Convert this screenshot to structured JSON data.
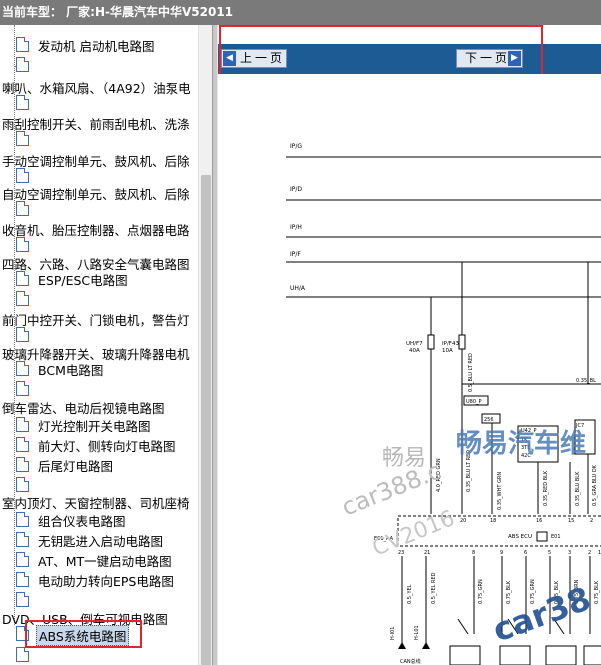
{
  "titlebar": {
    "text": "当前车型：  厂家:H-华晨汽车中华V52011"
  },
  "sidebar": {
    "items": [
      {
        "label": "发动机  启动机电路图"
      },
      {
        "label": "喇叭、水箱风扇、（4A92）油泵电"
      },
      {
        "label": "雨刮控制开关、前雨刮电机、洗涤"
      },
      {
        "label": "手动空调控制单元、鼓风机、后除"
      },
      {
        "label": "自动空调控制单元、鼓风机、后除"
      },
      {
        "label": "收音机、胎压控制器、点烟器电路"
      },
      {
        "label": "四路、六路、八路安全气囊电路图"
      },
      {
        "label": "ESP/ESC电路图"
      },
      {
        "label": "前门中控开关、门锁电机，警告灯"
      },
      {
        "label": "玻璃升降器开关、玻璃升降器电机"
      },
      {
        "label": "BCM电路图"
      },
      {
        "label": "倒车雷达、电动后视镜电路图"
      },
      {
        "label": "灯光控制开关电路图"
      },
      {
        "label": "前大灯、侧转向灯电路图"
      },
      {
        "label": "后尾灯电路图"
      },
      {
        "label": "室内顶灯、天窗控制器、司机座椅"
      },
      {
        "label": "组合仪表电路图"
      },
      {
        "label": "无钥匙进入启动电路图"
      },
      {
        "label": "AT、MT一键启动电路图"
      },
      {
        "label": "电动助力转向EPS电路图"
      },
      {
        "label": "DVD、USB、倒车可视电路图"
      },
      {
        "label": "ABS系统电路图"
      }
    ]
  },
  "nav": {
    "prev_label": "上一页",
    "next_label": "下一页"
  },
  "diagram": {
    "rails": [
      "IP/G",
      "IP/D",
      "IP/H",
      "IP/F",
      "UH/A"
    ],
    "fuse_left": {
      "line1": "UH/F7",
      "line2": "40A"
    },
    "fuse_right": {
      "line1": "IP/F43",
      "line2": "10A"
    },
    "wire_blu_lt_red": "0.5_BLU LT RED",
    "wire_blu_right": "0.35_BL",
    "connector_u80": "U80_P",
    "connector_256": "256",
    "connector_u42": "U42_P",
    "connector_u42_cells": [
      "1K",
      "3TE",
      "42C"
    ],
    "connector_jc": "JC7",
    "wire_red_grn": "4.0_RED GRN",
    "wire_blu_lt_red_2": "0.35_BLU LT RED",
    "wire_wht_grn": "0.35_WHT GRN",
    "wire_red_blk": "0.35_RED BLK",
    "wire_blu_blk": "0.35_BLU BLK",
    "wire_gra_blu_dk": "0.5_GRA BLU DK",
    "ecu_pins_top": [
      "20",
      "18",
      "16",
      "15",
      "2"
    ],
    "ecu_connector": "E01_AA",
    "ecu_label": "ABS ECU",
    "ecu_code": "E01",
    "ecu_pins_bottom": [
      "23",
      "21",
      "8",
      "9",
      "6",
      "5",
      "3",
      "2",
      "1"
    ],
    "wire_yel": "0.5_YEL",
    "wire_yel_red": "0.5_YEL RED",
    "bottom_wires": [
      "0.75_GRN",
      "0.75_BLK",
      "0.75_GRN",
      "0.75_BLK",
      "0.75_BRN",
      "0.75_BLK"
    ],
    "can_label_1": "H-I01",
    "can_label_2": "H-L01",
    "can_bus": "CAN总线",
    "watermarks": [
      "畅易",
      "畅易汽车维",
      "car388.c",
      "CV2016",
      "car38"
    ]
  },
  "colors": {
    "titlebar_bg": "#7a7a7a",
    "nav_bg": "#1c5b93",
    "highlight_red": "#e0262b",
    "selected_bg": "#c9d7ea"
  }
}
